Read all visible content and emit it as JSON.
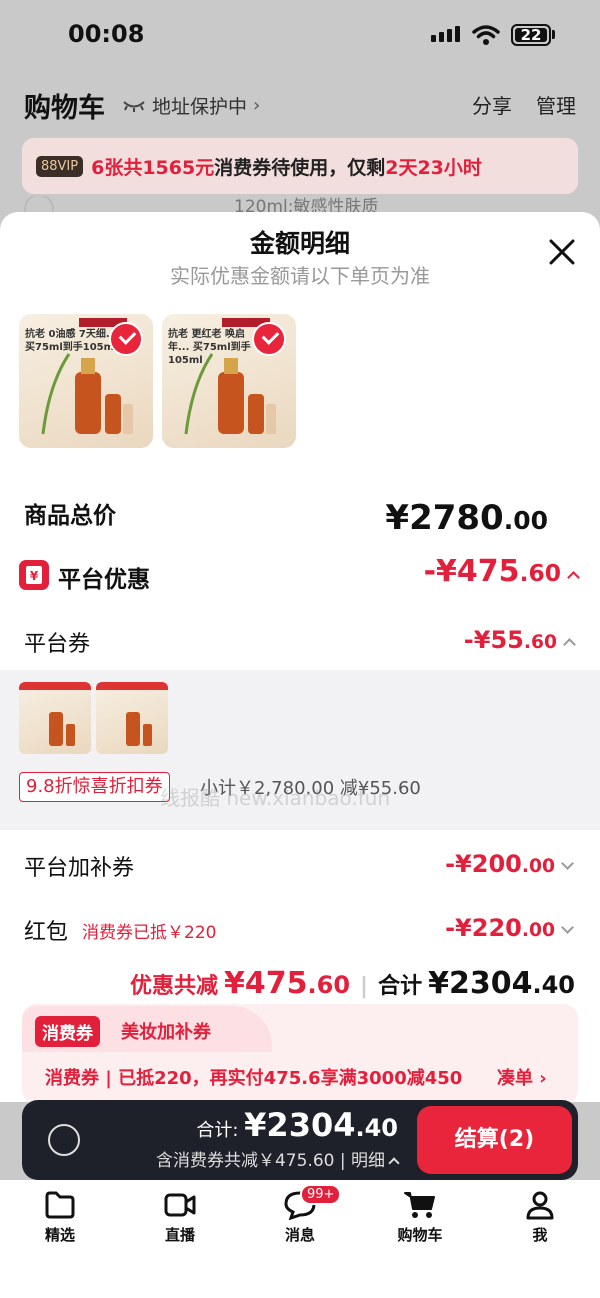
{
  "status": {
    "time": "00:08",
    "battery": "22"
  },
  "header": {
    "title": "购物车",
    "address": "地址保护中",
    "share": "分享",
    "manage": "管理"
  },
  "banner": {
    "vip": "88VIP",
    "part1": "6张共1565元",
    "part2": "消费券待使用，仅剩",
    "part3": "2天23小时"
  },
  "behind": {
    "desc": "120ml;敏感性肤质"
  },
  "sheet": {
    "title": "金额明细",
    "subtitle": "实际优惠金额请以下单页为准",
    "products": [
      {
        "text": "抗老 0油感 7天细... 买75ml到手105ml"
      },
      {
        "text": "抗老 更红老 唤启年... 买75ml到手105ml"
      }
    ],
    "goods_total_label": "商品总价",
    "goods_total_int": "¥2780",
    "goods_total_dec": ".00",
    "platform_label": "平台优惠",
    "platform_int": "-¥475",
    "platform_dec": ".60",
    "coupon_label": "平台券",
    "coupon_int": "-¥55",
    "coupon_dec": ".60",
    "coupon_tag": "9.8折惊喜折扣券",
    "coupon_subtotal": "小计￥2,780.00  减¥55.60",
    "watermark": "线报酷 new.xianbao.fun",
    "subsidy_label": "平台加补券",
    "subsidy_int": "-¥200",
    "subsidy_dec": ".00",
    "redpack_label": "红包",
    "redpack_note": "消费券已抵￥220",
    "redpack_int": "-¥220",
    "redpack_dec": ".00",
    "summary_discount_label": "优惠共减",
    "summary_discount_int": "¥475",
    "summary_discount_dec": ".60",
    "summary_total_label": "合计",
    "summary_total_int": "¥2304",
    "summary_total_dec": ".40",
    "voucher_tag": "消费券",
    "voucher_type": "美妆加补券",
    "voucher_line": "消费券 | 已抵220，再实付475.6享满3000减450",
    "voucher_action": "凑单"
  },
  "checkout": {
    "total_label": "合计:",
    "total_int": "¥2304",
    "total_dec": ".40",
    "sub": "含消费券共减￥475.60 | 明细",
    "button": "结算(2)"
  },
  "tabs": [
    {
      "label": "精选",
      "icon": "home-icon"
    },
    {
      "label": "直播",
      "icon": "video-icon"
    },
    {
      "label": "消息",
      "icon": "message-icon",
      "badge": "99+"
    },
    {
      "label": "购物车",
      "icon": "cart-icon"
    },
    {
      "label": "我",
      "icon": "profile-icon"
    }
  ],
  "colors": {
    "accent": "#e3203b",
    "checkout_bg": "#1e2129"
  }
}
